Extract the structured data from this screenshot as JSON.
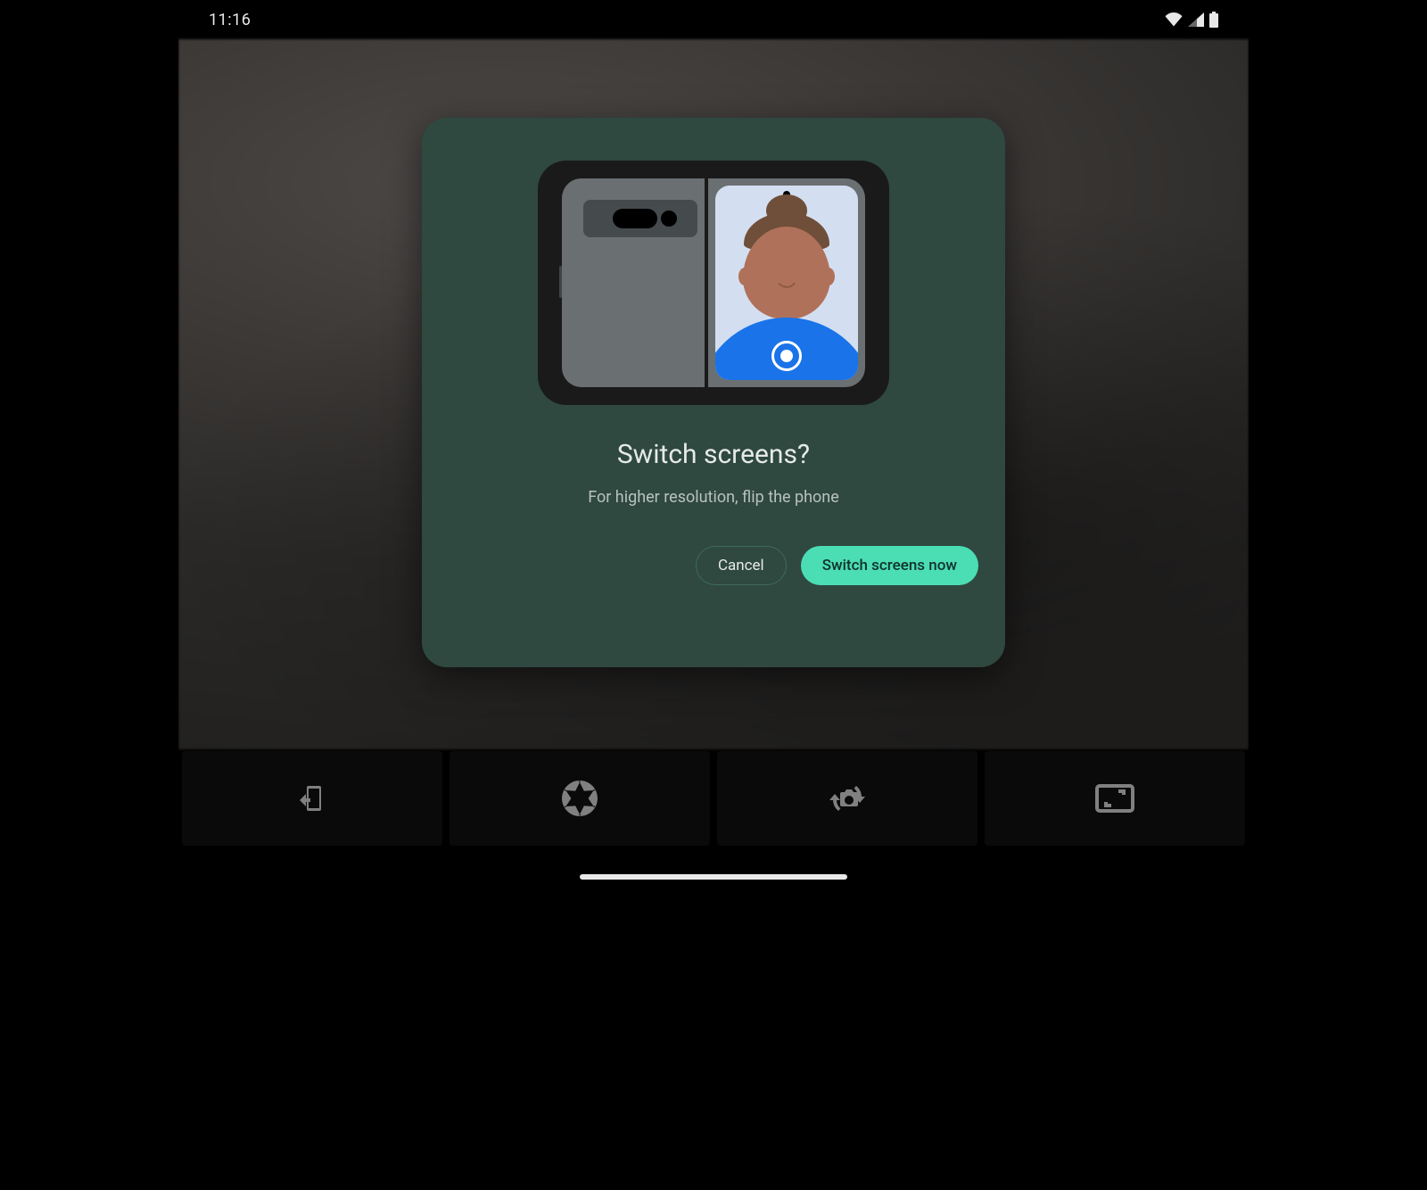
{
  "status": {
    "time": "11:16"
  },
  "dialog": {
    "title": "Switch screens?",
    "subtitle": "For higher resolution, flip the phone",
    "cancel_label": "Cancel",
    "confirm_label": "Switch screens now"
  },
  "toolbar": {
    "items": [
      {
        "icon": "switch-display-icon"
      },
      {
        "icon": "aperture-icon"
      },
      {
        "icon": "flip-camera-icon"
      },
      {
        "icon": "aspect-ratio-icon"
      }
    ]
  }
}
